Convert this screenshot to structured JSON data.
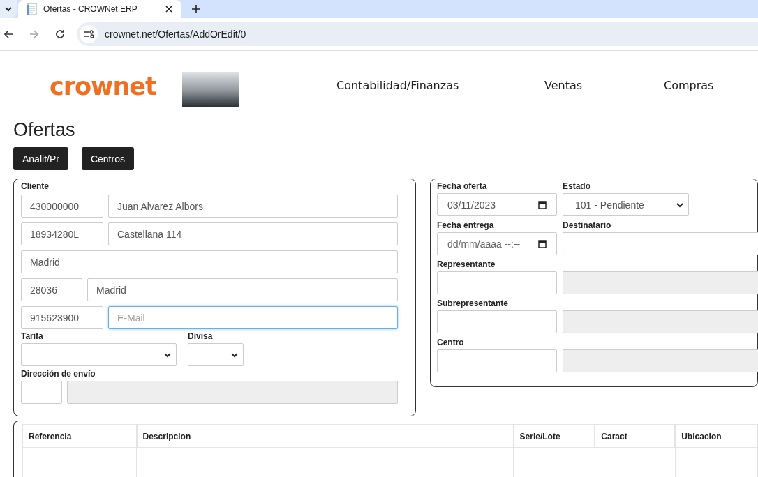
{
  "browser": {
    "tab_title": "Ofertas - CROWNet ERP",
    "url": "crownet.net/Ofertas/AddOrEdit/0",
    "forward_disabled": true
  },
  "header": {
    "logo": "crownet",
    "nav": [
      "Contabilidad/Finanzas",
      "Ventas",
      "Compras"
    ]
  },
  "page_title": "Ofertas",
  "buttons": [
    "Analit/Pr",
    "Centros"
  ],
  "cliente": {
    "legend": "Cliente",
    "rows": [
      {
        "kind": "pair",
        "fields": [
          {
            "value": "430000000",
            "focused": false
          },
          {
            "value": "Juan Alvarez Albors",
            "focused": false
          }
        ]
      },
      {
        "kind": "pair",
        "fields": [
          {
            "value": "18934280L",
            "focused": false
          },
          {
            "value": "Castellana 114",
            "focused": false
          }
        ]
      },
      {
        "kind": "single",
        "fields": [
          {
            "value": "Madrid",
            "focused": false
          }
        ]
      },
      {
        "kind": "short-pair",
        "fields": [
          {
            "value": "28036",
            "focused": false
          },
          {
            "value": "Madrid",
            "focused": false
          }
        ]
      },
      {
        "kind": "pair",
        "fields": [
          {
            "value": "915623900",
            "focused": false
          },
          {
            "placeholder": "E-Mail",
            "focused": true
          }
        ]
      }
    ],
    "tarifa": {
      "label": "Tarifa"
    },
    "divisa": {
      "label": "Divisa"
    },
    "direccion": {
      "label": "Dirección de envío",
      "fields": [
        {
          "disabled": false
        },
        {
          "disabled": true
        }
      ]
    }
  },
  "oferta": {
    "rows": [
      {
        "cells": [
          {
            "label": "Fecha oferta",
            "kind": "date",
            "value": "03/11/2023"
          },
          {
            "label": "Estado",
            "kind": "select",
            "value": "101 - Pendiente"
          }
        ]
      },
      {
        "cells": [
          {
            "label": "Fecha entrega",
            "kind": "date",
            "placeholder": "dd/mm/aaaa --:--"
          },
          {
            "label": "Destinatario",
            "kind": "text",
            "disabled": false
          }
        ]
      },
      {
        "label": "Representante",
        "cells": [
          {
            "kind": "text",
            "disabled": false
          },
          {
            "kind": "text",
            "disabled": true
          }
        ]
      },
      {
        "label": "Subrepresentante",
        "cells": [
          {
            "kind": "text",
            "disabled": false
          },
          {
            "kind": "text",
            "disabled": true
          }
        ]
      },
      {
        "label": "Centro",
        "cells": [
          {
            "kind": "text",
            "disabled": false
          },
          {
            "kind": "text",
            "disabled": true
          }
        ]
      }
    ]
  },
  "table": {
    "columns": [
      "Referencia",
      "Descripcion",
      "Serie/Lote",
      "Caract",
      "Ubicacion"
    ]
  }
}
